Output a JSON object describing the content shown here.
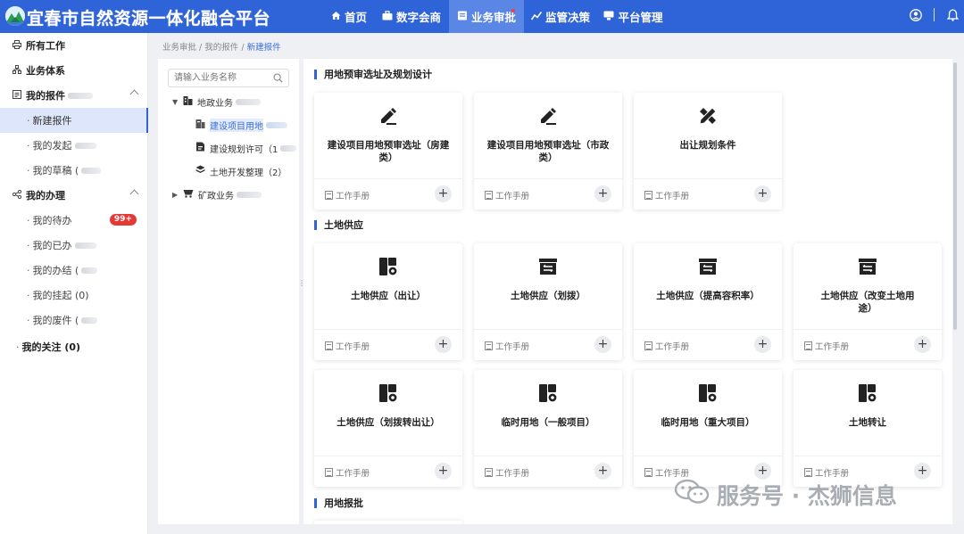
{
  "header": {
    "app_title": "宜春市自然资源一体化融合平台",
    "nav": [
      {
        "label": "首页",
        "icon": "home-icon"
      },
      {
        "label": "数字会商",
        "icon": "briefcase-icon"
      },
      {
        "label": "业务审批",
        "icon": "approval-icon",
        "active": true
      },
      {
        "label": "监管决策",
        "icon": "decision-icon"
      },
      {
        "label": "平台管理",
        "icon": "settings-icon"
      }
    ],
    "brand_color": "#2f63d8"
  },
  "sidebar": {
    "items": [
      {
        "label": "所有工作",
        "icon": "printer-icon",
        "level": 0
      },
      {
        "label": "业务体系",
        "icon": "org-icon",
        "level": 0
      },
      {
        "label": "我的报件",
        "icon": "doc-icon",
        "level": 0,
        "expanded": true
      },
      {
        "label": "新建报件",
        "level": 1,
        "active": true
      },
      {
        "label": "我的发起",
        "level": 1
      },
      {
        "label": "我的草稿 (",
        "level": 1
      },
      {
        "label": "我的办理",
        "icon": "share-icon",
        "level": 0,
        "expanded": true
      },
      {
        "label": "我的待办",
        "level": 1,
        "badge": "99+"
      },
      {
        "label": "我的已办",
        "level": 1
      },
      {
        "label": "我的办结 (",
        "level": 1
      },
      {
        "label": "我的挂起 (0)",
        "level": 1
      },
      {
        "label": "我的废件 (",
        "level": 1
      },
      {
        "label": "我的关注 (0)",
        "level": 0
      }
    ]
  },
  "breadcrumb": {
    "items": [
      "业务审批",
      "我的报件",
      "新建报件"
    ],
    "separator": "/"
  },
  "tree": {
    "search_placeholder": "请输入业务名称",
    "nodes": [
      {
        "label": "地政业务",
        "level": 0,
        "expanded": true
      },
      {
        "label": "建设项目用地",
        "level": 1,
        "selected": true
      },
      {
        "label": "建设规划许可（1",
        "level": 1
      },
      {
        "label": "土地开发整理（2）",
        "level": 1
      },
      {
        "label": "矿政业务",
        "level": 0,
        "expanded": false
      }
    ]
  },
  "sections": [
    {
      "title": "用地预审选址及规划设计",
      "cards": [
        {
          "title": "建设项目用地预审选址（房建类）",
          "icon": "edit-icon"
        },
        {
          "title": "建设项目用地预审选址（市政类）",
          "icon": "edit-icon"
        },
        {
          "title": "出让规划条件",
          "icon": "ruler-pencil-icon"
        }
      ]
    },
    {
      "title": "土地供应",
      "cards": [
        {
          "title": "土地供应（出让）",
          "icon": "land-parcel-icon"
        },
        {
          "title": "土地供应（划拨）",
          "icon": "transfer-box-icon"
        },
        {
          "title": "土地供应（提高容积率）",
          "icon": "transfer-box-icon"
        },
        {
          "title": "土地供应（改变土地用途）",
          "icon": "transfer-box-icon"
        },
        {
          "title": "土地供应（划拨转出让）",
          "icon": "land-parcel-icon"
        },
        {
          "title": "临时用地（一般项目）",
          "icon": "land-parcel-icon"
        },
        {
          "title": "临时用地（重大项目）",
          "icon": "land-parcel-icon"
        },
        {
          "title": "土地转让",
          "icon": "land-parcel-icon"
        }
      ]
    },
    {
      "title": "用地报批",
      "cards": []
    }
  ],
  "card_common": {
    "manual_label": "工作手册",
    "add_label": "+"
  },
  "watermark": {
    "text": "服务号 · 杰狮信息",
    "icon": "wechat-icon"
  }
}
